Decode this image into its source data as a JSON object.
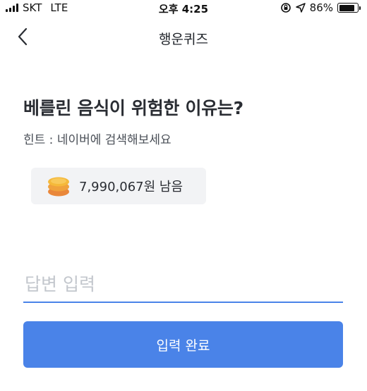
{
  "status_bar": {
    "carrier": "SKT",
    "network": "LTE",
    "time": "오후 4:25",
    "battery_percent": "86%",
    "battery_level": 0.86
  },
  "header": {
    "title": "행운퀴즈",
    "back_icon": "chevron-left-icon"
  },
  "quiz": {
    "question": "베를린 음식이 위험한 이유는?",
    "hint": "힌트 : 네이버에 검색해보세요"
  },
  "reward": {
    "icon": "coin-stack-icon",
    "text": "7,990,067원 남음"
  },
  "answer": {
    "placeholder": "답변 입력",
    "value": ""
  },
  "submit": {
    "label": "입력 완료"
  },
  "colors": {
    "accent": "#4a83e8",
    "coin_top": "#f5b93a",
    "coin_bottom": "#e9873a"
  }
}
